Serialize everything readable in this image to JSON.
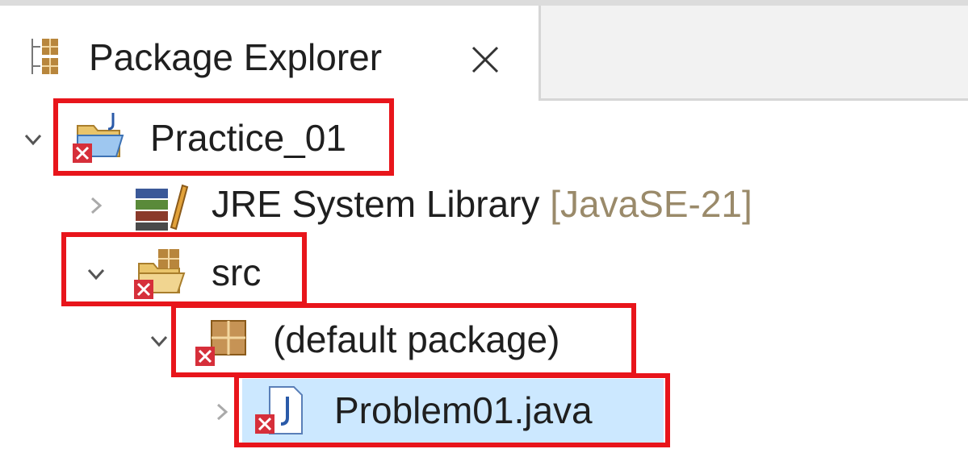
{
  "view": {
    "icon": "package-explorer-icon",
    "title": "Package Explorer",
    "close_icon": "close-icon"
  },
  "tree": {
    "project": {
      "label": "Practice_01",
      "icon": "java-project-error-icon",
      "expanded": true,
      "children": {
        "jre": {
          "label": "JRE System Library",
          "decoration": "[JavaSE-21]",
          "icon": "library-icon",
          "expanded": false
        },
        "src": {
          "label": "src",
          "icon": "source-folder-error-icon",
          "expanded": true,
          "children": {
            "package": {
              "label": "(default package)",
              "icon": "package-error-icon",
              "expanded": true,
              "children": {
                "file": {
                  "label": "Problem01.java",
                  "icon": "java-file-error-icon",
                  "expanded": false,
                  "selected": true
                }
              }
            }
          }
        }
      }
    }
  },
  "colors": {
    "highlight": "#e8151b",
    "selection": "#cce8ff",
    "error_badge": "#d62f3a"
  }
}
